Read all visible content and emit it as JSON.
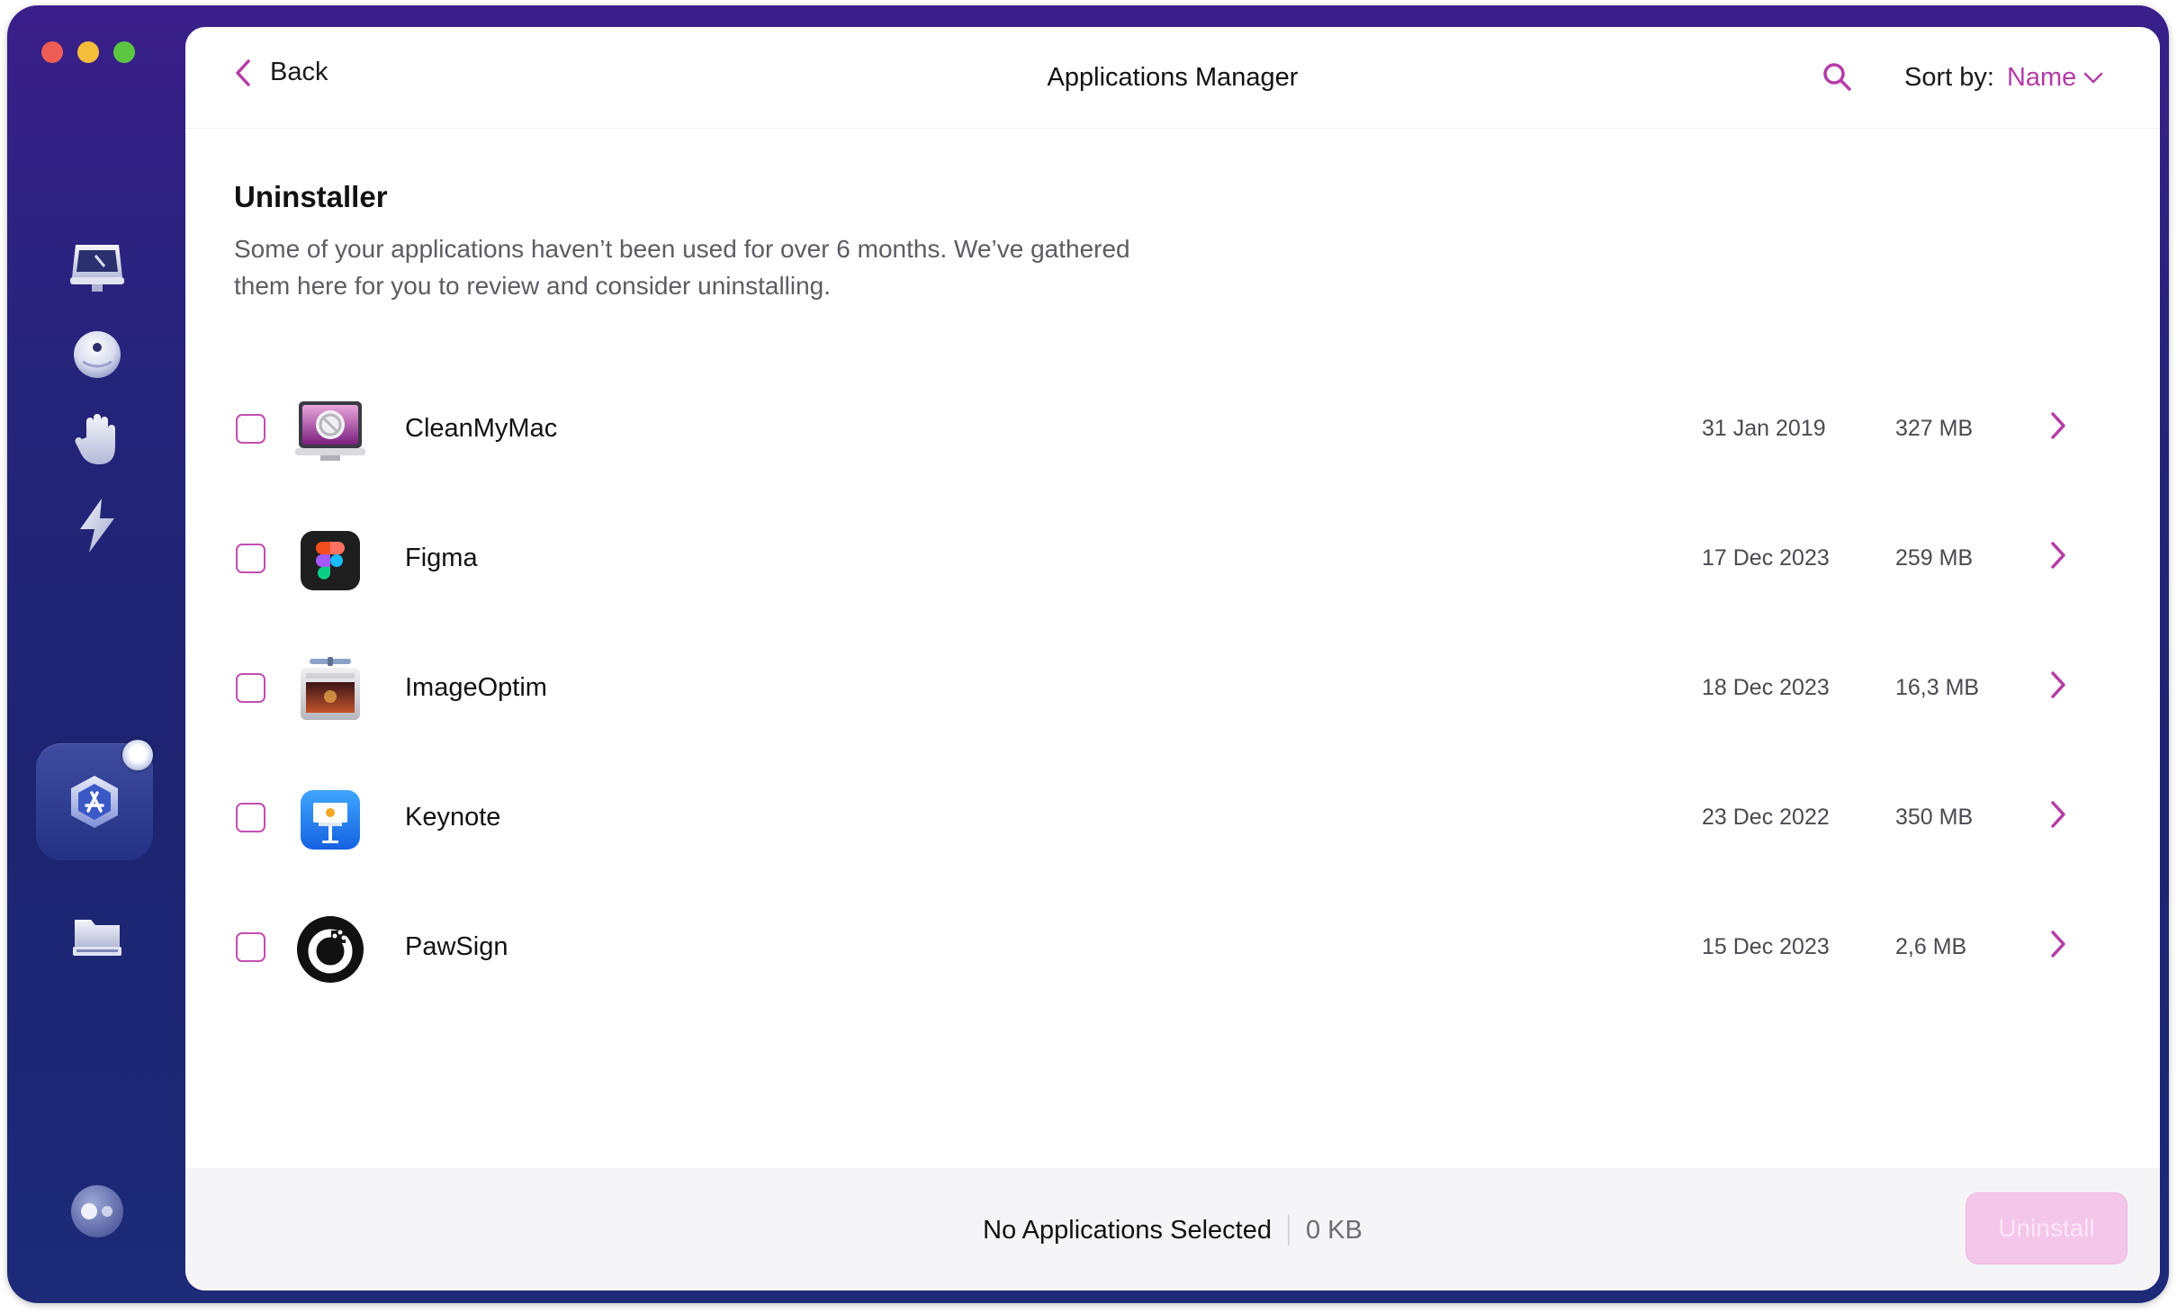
{
  "window": {
    "traffic_lights": [
      "close",
      "minimize",
      "zoom"
    ]
  },
  "sidebar": {
    "items": [
      {
        "name": "smart-care",
        "icon": "monitor-icon"
      },
      {
        "name": "protection",
        "icon": "orb-icon"
      },
      {
        "name": "privacy",
        "icon": "hand-icon"
      },
      {
        "name": "speed",
        "icon": "lightning-icon"
      },
      {
        "name": "applications",
        "icon": "app-store-icon",
        "active": true
      },
      {
        "name": "files",
        "icon": "folder-icon"
      }
    ],
    "assistant_icon": "assistant-icon"
  },
  "header": {
    "back_label": "Back",
    "title": "Applications Manager",
    "sort_label": "Sort by:",
    "sort_value": "Name"
  },
  "section": {
    "title": "Uninstaller",
    "description": "Some of your applications haven’t been used for over 6 months. We’ve gathered them here for you to review and consider uninstalling."
  },
  "apps": [
    {
      "name": "CleanMyMac",
      "date": "31 Jan 2019",
      "size": "327 MB",
      "icon": "cleanmymac-icon"
    },
    {
      "name": "Figma",
      "date": "17 Dec 2023",
      "size": "259 MB",
      "icon": "figma-icon"
    },
    {
      "name": "ImageOptim",
      "date": "18 Dec 2023",
      "size": "16,3 MB",
      "icon": "imageoptim-icon"
    },
    {
      "name": "Keynote",
      "date": "23 Dec 2022",
      "size": "350 MB",
      "icon": "keynote-icon"
    },
    {
      "name": "PawSign",
      "date": "15 Dec 2023",
      "size": "2,6 MB",
      "icon": "pawsign-icon"
    }
  ],
  "footer": {
    "status": "No Applications Selected",
    "total_size": "0 KB",
    "uninstall_label": "Uninstall"
  },
  "colors": {
    "accent": "#b43ca6",
    "sidebar_top": "#3a1f8a",
    "sidebar_bottom": "#1c2a78",
    "button_disabled": "#f4c6ea"
  }
}
